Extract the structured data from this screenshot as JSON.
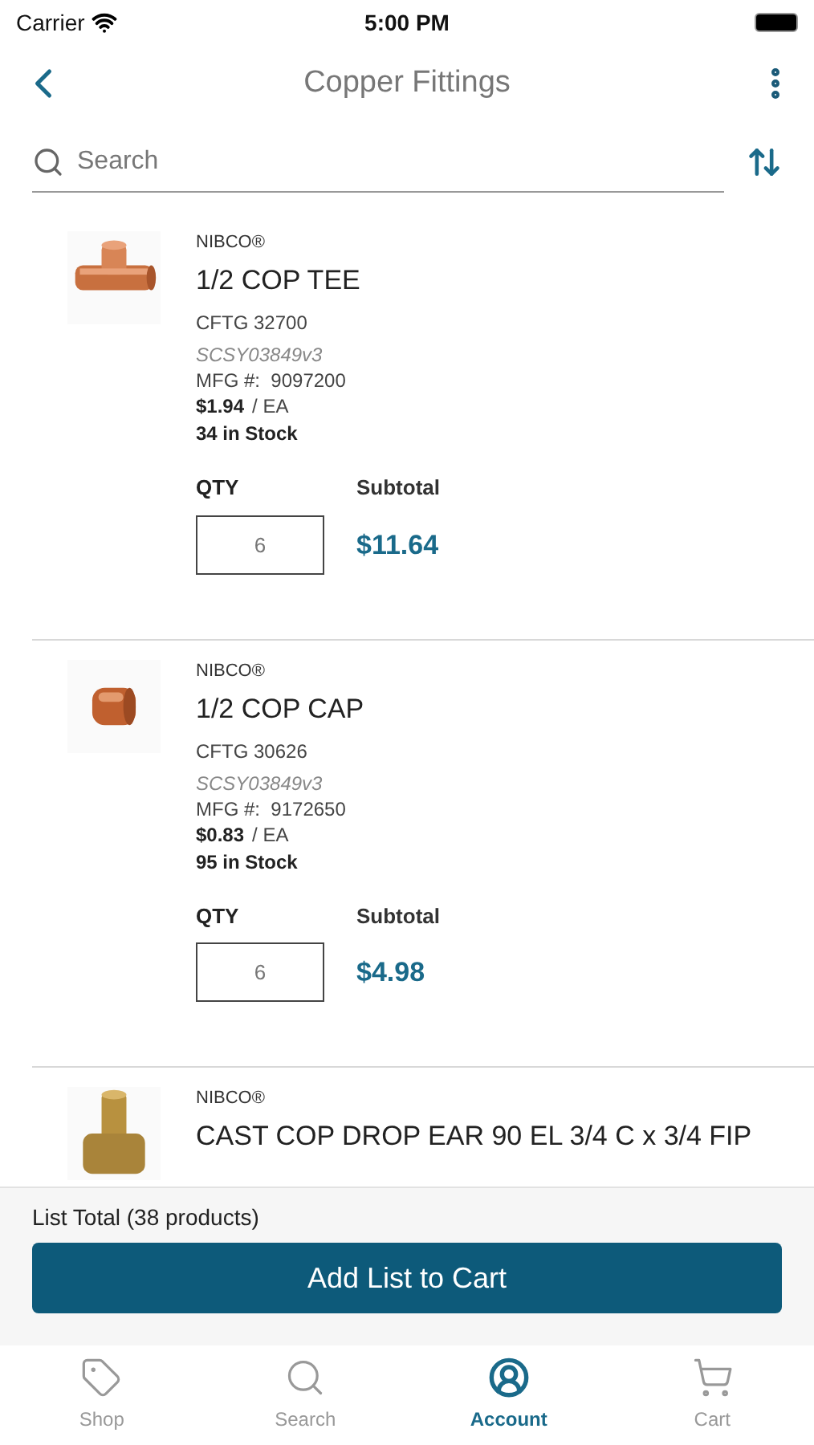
{
  "status_bar": {
    "carrier": "Carrier",
    "time": "5:00 PM"
  },
  "nav": {
    "title": "Copper Fittings"
  },
  "search": {
    "placeholder": "Search"
  },
  "products": [
    {
      "brand": "NIBCO®",
      "name": "1/2 COP TEE",
      "code": "CFTG 32700",
      "sku": "SCSY03849v3",
      "mfg": "MFG #:  9097200",
      "price": "$1.94",
      "unit": "/ EA",
      "stock": "34 in Stock",
      "qty_label": "QTY",
      "qty": "6",
      "subtotal_label": "Subtotal",
      "subtotal": "$11.64"
    },
    {
      "brand": "NIBCO®",
      "name": "1/2 COP CAP",
      "code": "CFTG 30626",
      "sku": "SCSY03849v3",
      "mfg": "MFG #:  9172650",
      "price": "$0.83",
      "unit": "/ EA",
      "stock": "95 in Stock",
      "qty_label": "QTY",
      "qty": "6",
      "subtotal_label": "Subtotal",
      "subtotal": "$4.98"
    },
    {
      "brand": "NIBCO®",
      "name": "CAST COP DROP EAR 90 EL 3/4 C x 3/4 FIP"
    }
  ],
  "footer": {
    "total": "List Total (38 products)",
    "button": "Add List to Cart"
  },
  "tabs": [
    {
      "label": "Shop",
      "selected": false
    },
    {
      "label": "Search",
      "selected": false
    },
    {
      "label": "Account",
      "selected": true
    },
    {
      "label": "Cart",
      "selected": false
    }
  ]
}
